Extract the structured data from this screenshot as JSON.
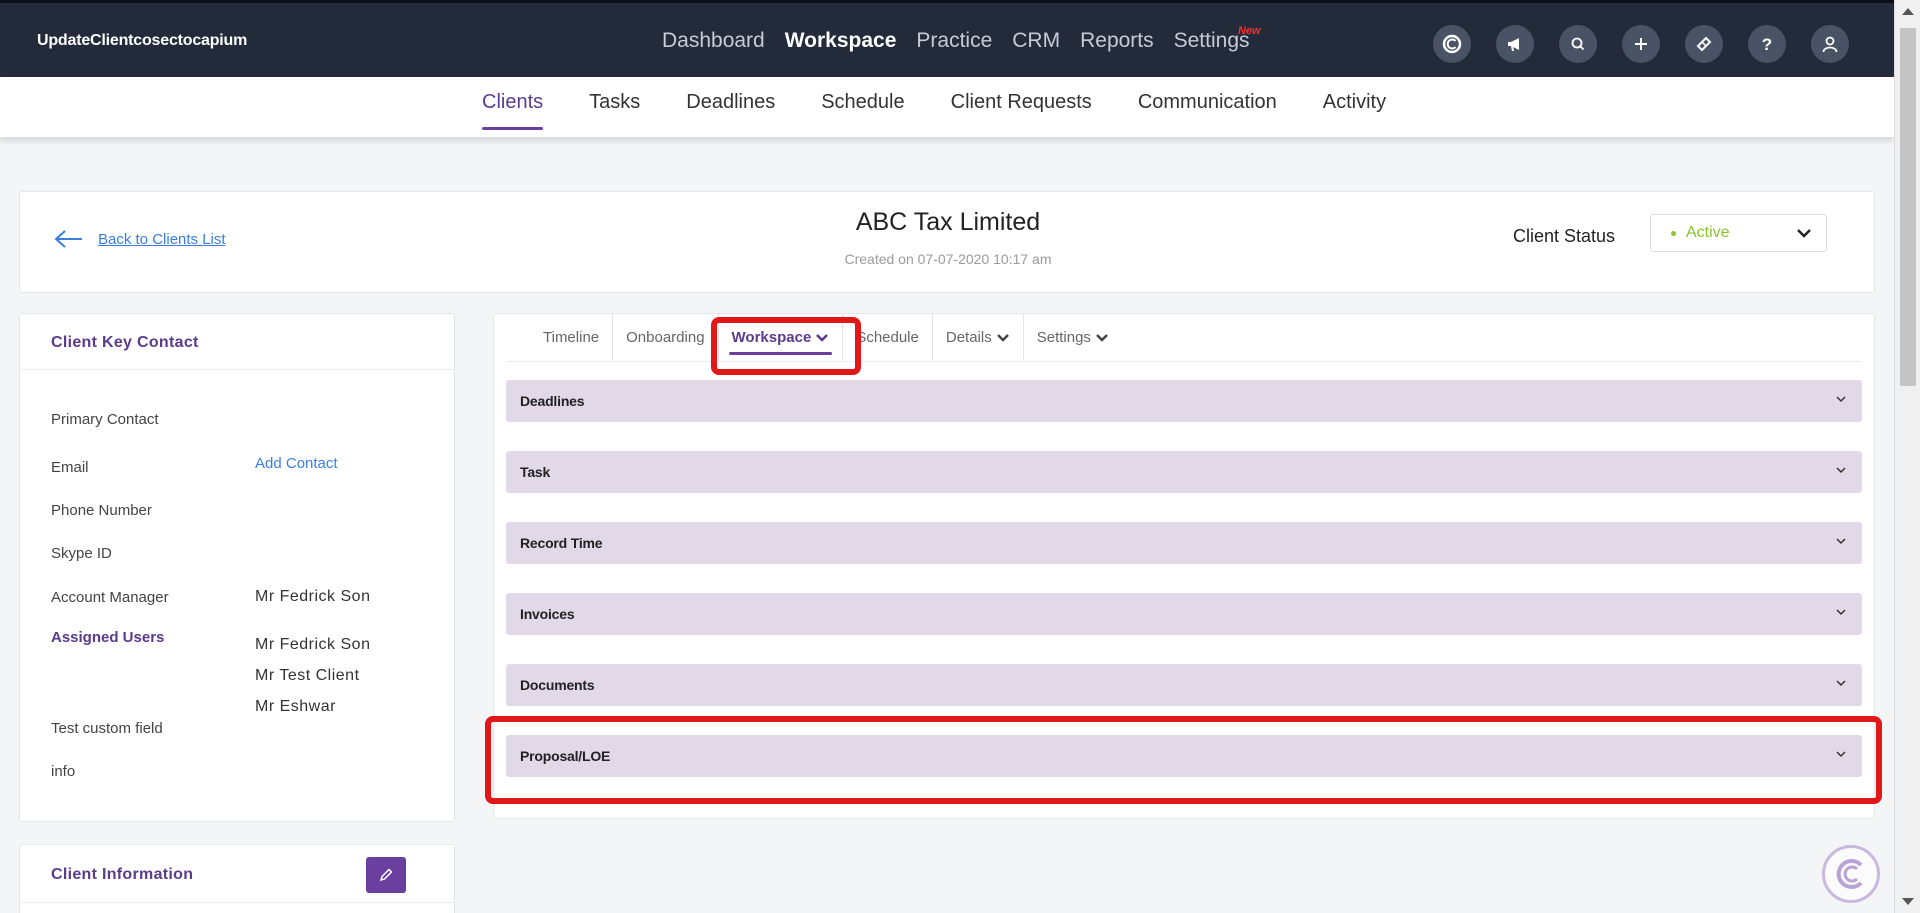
{
  "app": {
    "title": "UpdateClientcosectocapium"
  },
  "main_nav": {
    "items": [
      "Dashboard",
      "Workspace",
      "Practice",
      "CRM",
      "Reports",
      "Settings"
    ],
    "active": "Workspace",
    "new_badge": "New"
  },
  "top_icons": [
    "capium-logo-icon",
    "megaphone-icon",
    "search-icon",
    "plus-icon",
    "ticket-icon",
    "help-icon",
    "user-icon"
  ],
  "sub_nav": {
    "items": [
      "Clients",
      "Tasks",
      "Deadlines",
      "Schedule",
      "Client Requests",
      "Communication",
      "Activity"
    ],
    "active": "Clients"
  },
  "header": {
    "back_label": "Back to Clients List",
    "client_name": "ABC Tax Limited",
    "created": "Created on 07-07-2020 10:17 am",
    "status_label": "Client Status",
    "status_value": "Active"
  },
  "key_contact": {
    "title": "Client Key Contact",
    "primary_contact": "Primary Contact",
    "email_label": "Email",
    "add_contact": "Add Contact",
    "phone_label": "Phone Number",
    "skype_label": "Skype ID",
    "account_manager_label": "Account Manager",
    "account_manager_value": "Mr Fedrick Son",
    "assigned_users_label": "Assigned Users",
    "assigned_users": [
      "Mr Fedrick Son",
      "Mr Test Client",
      "Mr Eshwar"
    ],
    "custom_field_label": "Test custom field",
    "info_label": "info"
  },
  "client_info": {
    "title": "Client Information"
  },
  "tabs": {
    "items": [
      "Timeline",
      "Onboarding",
      "Workspace",
      "Schedule",
      "Details",
      "Settings"
    ],
    "active": "Workspace"
  },
  "sections": [
    "Deadlines",
    "Task",
    "Record Time",
    "Invoices",
    "Documents",
    "Proposal/LOE"
  ],
  "colors": {
    "nav_bg": "#232b3a",
    "accent": "#6a3fa0",
    "section_bg": "#e1d8e8",
    "highlight": "#e01818",
    "active_status": "#8ac42f"
  }
}
